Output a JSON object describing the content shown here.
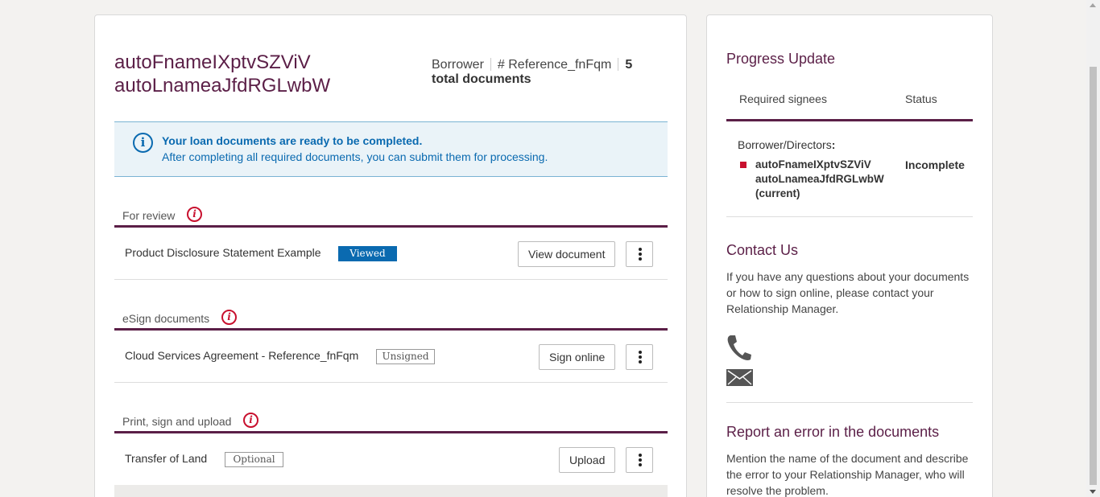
{
  "applicant": {
    "first_name": "autoFnameIXptvSZViV",
    "last_name": "autoLnameaJfdRGLwbW"
  },
  "meta": {
    "role": "Borrower",
    "reference": "# Reference_fnFqm",
    "doc_count": "5",
    "doc_count_label": "total documents"
  },
  "alert": {
    "icon": "info-icon",
    "title": "Your loan documents are ready to be completed.",
    "body": "After completing all required documents, you can submit them for processing."
  },
  "sections": [
    {
      "label": "For review",
      "document": {
        "name": "Product Disclosure Statement Example",
        "badge": "Viewed",
        "action": "View document"
      }
    },
    {
      "label": "eSign documents",
      "document": {
        "name": "Cloud Services Agreement - Reference_fnFqm",
        "badge": "Unsigned",
        "action": "Sign online"
      }
    },
    {
      "label": "Print, sign and upload",
      "document": {
        "name": "Transfer of Land",
        "badge": "Optional",
        "action": "Upload"
      }
    }
  ],
  "sidebar": {
    "progress_title": "Progress Update",
    "col_signees": "Required signees",
    "col_status": "Status",
    "group_label": "Borrower/Directors",
    "group_colon": ":",
    "signee_line1": "autoFnameIXptvSZViV",
    "signee_line2": "autoLnameaJfdRGLwbW",
    "signee_line3": "(current)",
    "signee_status": "Incomplete",
    "contact_title": "Contact Us",
    "contact_text": "If you have any questions about your documents or how to sign online, please contact your Relationship Manager.",
    "report_title": "Report an error in the documents",
    "report_text": "Mention the name of the document and describe the error to your Relationship Manager, who will resolve the problem."
  },
  "colors": {
    "brand": "#5b1f47",
    "info": "#0a6ab0",
    "alert": "#c8102e"
  }
}
